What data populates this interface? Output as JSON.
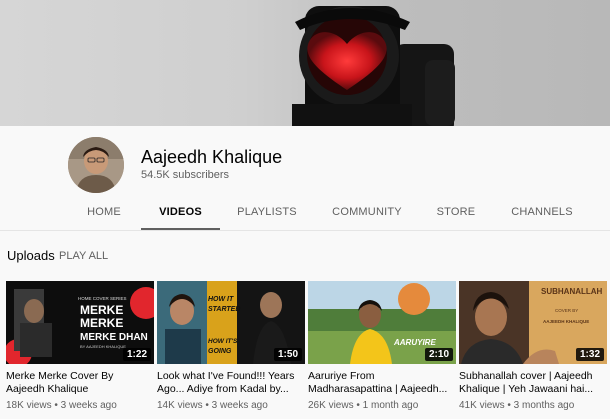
{
  "channel": {
    "name": "Aajeedh Khalique",
    "subscribers": "54.5K subscribers"
  },
  "tabs": [
    {
      "label": "HOME",
      "active": false
    },
    {
      "label": "VIDEOS",
      "active": true
    },
    {
      "label": "PLAYLISTS",
      "active": false
    },
    {
      "label": "COMMUNITY",
      "active": false
    },
    {
      "label": "STORE",
      "active": false
    },
    {
      "label": "CHANNELS",
      "active": false
    }
  ],
  "shelf": {
    "title": "Uploads",
    "play_all": "PLAY ALL"
  },
  "videos": [
    {
      "title": "Merke Merke Cover By Aajeedh Khalique",
      "duration": "1:22",
      "views": "18K views",
      "dot": "•",
      "age": "3 weeks ago",
      "thumb_text": [
        "HOME COVER SERIES",
        "MERKE",
        "MERKE",
        "MERKE DHAN",
        "BY AAJEEDH KHALIQUE"
      ]
    },
    {
      "title": "Look what I've Found!!! Years Ago... Adiye from Kadal by...",
      "duration": "1:50",
      "views": "14K views",
      "dot": "•",
      "age": "3 weeks ago",
      "thumb_text": [
        "HOW IT",
        "STARTED",
        "HOW IT'S",
        "GOING"
      ]
    },
    {
      "title": "Aaruriye From Madharasapattina | Aajeedh...",
      "duration": "2:10",
      "views": "26K views",
      "dot": "•",
      "age": "1 month ago",
      "thumb_text": [
        "AARUYIRE"
      ]
    },
    {
      "title": "Subhanallah cover | Aajeedh Khalique | Yeh Jawaani hai...",
      "duration": "1:32",
      "views": "41K views",
      "dot": "•",
      "age": "3 months ago",
      "thumb_text": [
        "SUBHANALLAH",
        "COVER BY",
        "AAJEEDH KHALIQUE"
      ]
    }
  ],
  "colors": {
    "accent_red": "#e1262d",
    "tab_underline": "#606060",
    "text_secondary": "#606060"
  }
}
